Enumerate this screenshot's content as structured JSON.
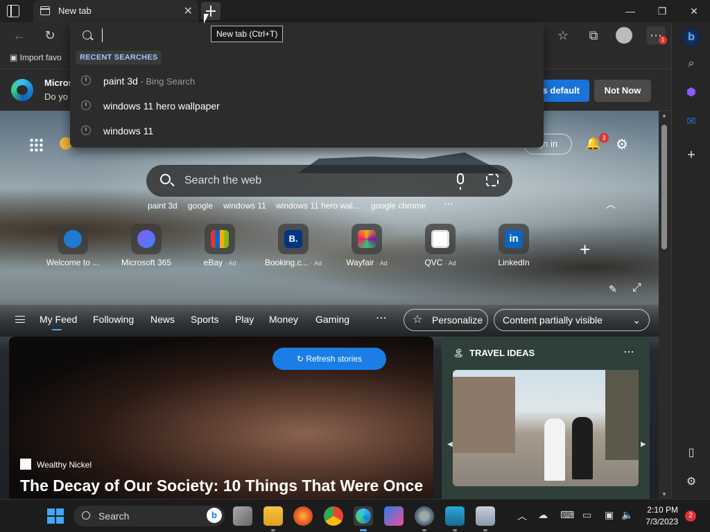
{
  "tab": {
    "title": "New tab"
  },
  "tooltip": "New tab (Ctrl+T)",
  "address_dropdown": {
    "input_value": "",
    "recent_header": "RECENT SEARCHES",
    "items": [
      {
        "text": "paint 3d",
        "sub": " - Bing Search"
      },
      {
        "text": "windows 11 hero wallpaper",
        "sub": ""
      },
      {
        "text": "windows 11",
        "sub": ""
      }
    ]
  },
  "favorites": {
    "import_label": "Import favo"
  },
  "banner": {
    "line1": "Micros",
    "line2": "Do yo",
    "set_default": "s default",
    "not_now": "Not Now"
  },
  "ntp": {
    "signin": "gn in",
    "bell_badge": "3",
    "search_placeholder": "Search the web",
    "trending": [
      "paint 3d",
      "google",
      "windows 11",
      "windows 11 hero wal...",
      "google chrome"
    ],
    "tiles": [
      {
        "label": "Welcome to ...",
        "ad": "",
        "color": "#1f7bd1"
      },
      {
        "label": "Microsoft 365",
        "ad": "",
        "color": "#8b5cf6"
      },
      {
        "label": "eBay",
        "ad": "· Ad",
        "color": "#e53238"
      },
      {
        "label": "Booking.c...",
        "ad": "· Ad",
        "color": "#003580"
      },
      {
        "label": "Wayfair",
        "ad": "· Ad",
        "color": "#7b189f"
      },
      {
        "label": "QVC",
        "ad": "· Ad",
        "color": "#ffffff"
      },
      {
        "label": "LinkedIn",
        "ad": "",
        "color": "#0a66c2"
      }
    ]
  },
  "feed_nav": {
    "items": [
      "My Feed",
      "Following",
      "News",
      "Sports",
      "Play",
      "Money",
      "Gaming"
    ],
    "personalize": "Personalize",
    "content_visibility": "Content partially visible"
  },
  "main_card": {
    "refresh": "Refresh stories",
    "source": "Wealthy Nickel",
    "headline": "The Decay of Our Society: 10 Things That Were Once"
  },
  "travel_card": {
    "title": "TRAVEL IDEAS"
  },
  "sidebar_badge": "1",
  "taskbar": {
    "search_label": "Search",
    "time": "2:10 PM",
    "date": "7/3/2023",
    "notif_count": "2"
  }
}
